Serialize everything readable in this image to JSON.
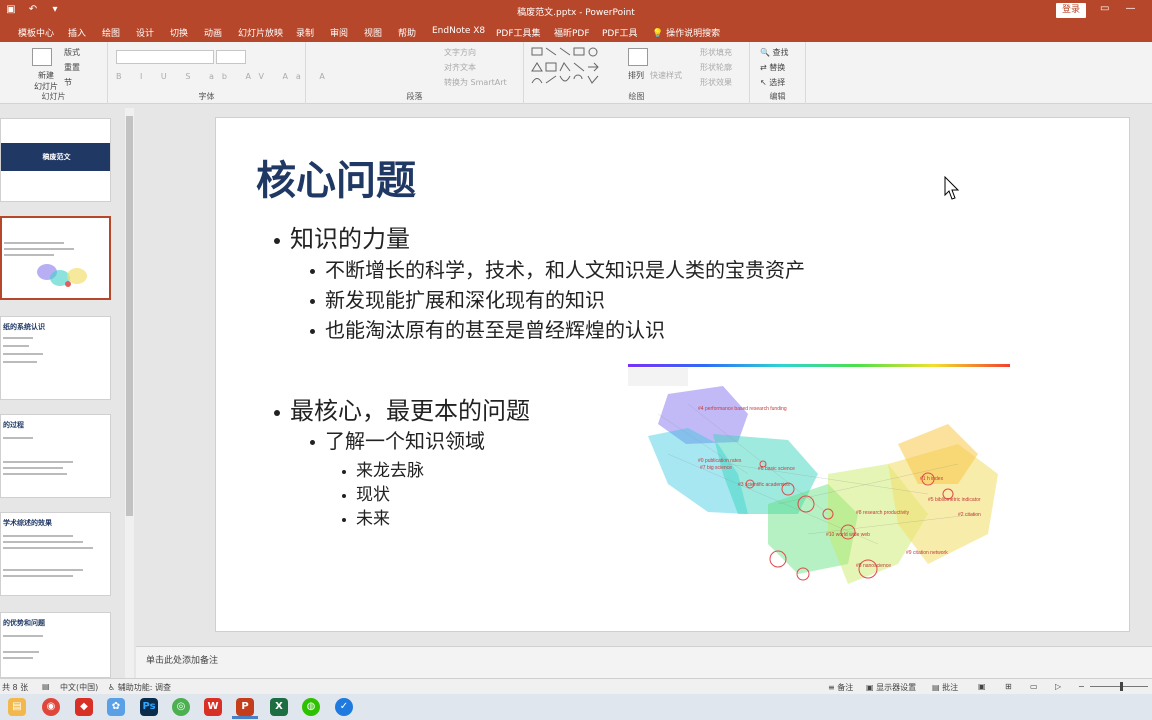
{
  "window": {
    "doc_title": "稿废范文.pptx  -  PowerPoint",
    "login_label": "登录"
  },
  "menu": {
    "tabs": [
      "模板中心",
      "插入",
      "绘图",
      "设计",
      "切换",
      "动画",
      "幻灯片放映",
      "录制",
      "审阅",
      "视图",
      "帮助",
      "EndNote X8",
      "PDF工具集",
      "福昕PDF",
      "PDF工具",
      "操作说明搜索"
    ]
  },
  "ribbon": {
    "slides_group": {
      "new_slide": "新建\n幻灯片",
      "layout": "版式",
      "reset": "重置",
      "section": "节",
      "label": "幻灯片"
    },
    "font_group": {
      "label": "字体",
      "buttons": [
        "B",
        "I",
        "U",
        "S",
        "ab",
        "AV",
        "Aa",
        "A"
      ]
    },
    "paragraph_group": {
      "label": "段落",
      "text_direction": "文字方向",
      "align_text": "对齐文本",
      "convert_smartart": "转换为 SmartArt"
    },
    "drawing_group": {
      "label": "绘图",
      "arrange": "排列",
      "quick_styles": "快速样式",
      "shape_fill": "形状填充",
      "shape_outline": "形状轮廓",
      "shape_effects": "形状效果"
    },
    "editing_group": {
      "label": "编辑",
      "find": "查找",
      "replace": "替换",
      "select": "选择"
    }
  },
  "thumbnails": [
    {
      "band_text": "稿废范文"
    },
    {
      "title": ""
    },
    {
      "title": "纸的系统认识"
    },
    {
      "title": "的过程"
    },
    {
      "title": "学术综述的效果"
    },
    {
      "title": "的优势和问题"
    }
  ],
  "slide": {
    "title": "核心问题",
    "bullets": [
      {
        "level": 1,
        "text": "知识的力量"
      },
      {
        "level": 2,
        "text": "不断增长的科学，技术，和人文知识是人类的宝贵资产"
      },
      {
        "level": 2,
        "text": "新发现能扩展和深化现有的知识"
      },
      {
        "level": 2,
        "text": "也能淘汰原有的甚至是曾经辉煌的认识"
      },
      {
        "level": 1,
        "text": "最核心，最更本的问题"
      },
      {
        "level": 2,
        "text": "了解一个知识领域"
      },
      {
        "level": 3,
        "text": "来龙去脉"
      },
      {
        "level": 3,
        "text": "现状"
      },
      {
        "level": 3,
        "text": "未来"
      }
    ],
    "viz_labels": [
      "#4 performance based research funding",
      "#0 publication rates",
      "#7 big science",
      "#6 basic science",
      "#3 scientific academies",
      "#1 h index",
      "#5 bibliometric indicator",
      "#2 citation",
      "#8 research productivity",
      "#10 world wide web",
      "#9 citation network",
      "#8 nanoscience"
    ]
  },
  "notes": {
    "placeholder": "单击此处添加备注"
  },
  "status": {
    "slide_count": "共 8 张",
    "language": "中文(中国)",
    "accessibility": "辅助功能: 调查",
    "notes_btn": "备注",
    "display_settings": "显示器设置",
    "comments_btn": "批注"
  },
  "colors": {
    "accent": "#b7472a",
    "title": "#1f3864"
  }
}
